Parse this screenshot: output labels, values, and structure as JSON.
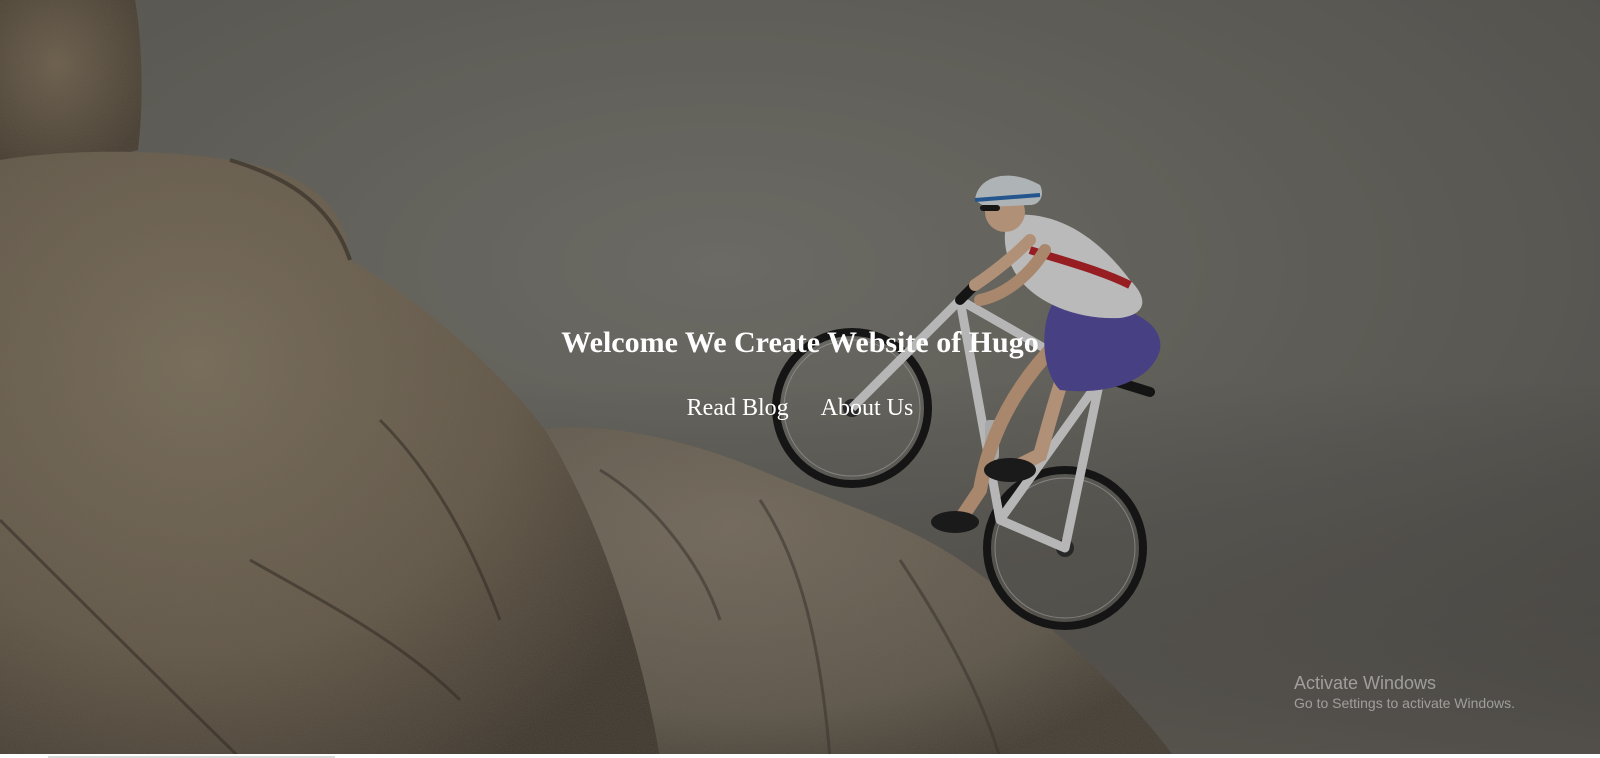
{
  "hero": {
    "title": "Welcome We Create Website of Hugo",
    "background": "mountain-biker-on-boulders-photo"
  },
  "nav": {
    "items": [
      {
        "label": "Read Blog"
      },
      {
        "label": "About Us"
      }
    ]
  },
  "watermark": {
    "title": "Activate Windows",
    "subtitle": "Go to Settings to activate Windows."
  },
  "colors": {
    "text": "#ffffff",
    "overlay": "#000000",
    "sky": "#78766f",
    "rock": "#8a7a64"
  }
}
